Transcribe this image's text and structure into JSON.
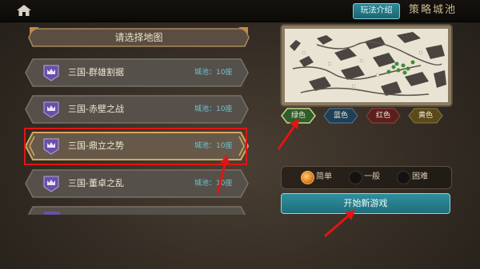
{
  "topbar": {
    "home_icon": "home-icon",
    "help_label": "玩法介绍",
    "title": "策略城池"
  },
  "map_list": {
    "header": "请选择地图",
    "items": [
      {
        "name": "三国-群雄割据",
        "cities": "城池：10座",
        "icon": "crown-banner-icon",
        "selected": false
      },
      {
        "name": "三国-赤壁之战",
        "cities": "城池：10座",
        "icon": "crown-banner-icon",
        "selected": false
      },
      {
        "name": "三国-鼎立之势",
        "cities": "城池：10座",
        "icon": "crown-banner-icon",
        "selected": true
      },
      {
        "name": "三国-董卓之乱",
        "cities": "城池：10座",
        "icon": "crown-banner-icon",
        "selected": false
      }
    ]
  },
  "colors": {
    "items": [
      {
        "label": "绿色",
        "fill": "#2f5d2c",
        "selected": true
      },
      {
        "label": "蓝色",
        "fill": "#1f3f57",
        "selected": false
      },
      {
        "label": "红色",
        "fill": "#5c1f1d",
        "selected": false
      },
      {
        "label": "黄色",
        "fill": "#5a4a1b",
        "selected": false
      }
    ]
  },
  "difficulty": {
    "options": [
      {
        "label": "简单",
        "selected": true
      },
      {
        "label": "一般",
        "selected": false
      },
      {
        "label": "困难",
        "selected": false
      }
    ]
  },
  "start_button": {
    "label": "开始新游戏"
  },
  "palette": {
    "accent_teal": "#2f8f9d",
    "annotation_red": "#e01515",
    "row_border_gold": "#d6a85a"
  }
}
